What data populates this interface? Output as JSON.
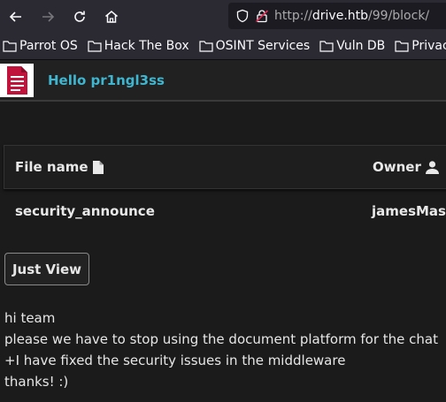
{
  "browser": {
    "url_prefix": "http://",
    "url_host": "drive.htb",
    "url_path": "/99/block/",
    "bookmarks": [
      "Parrot OS",
      "Hack The Box",
      "OSINT Services",
      "Vuln DB",
      "Privacy"
    ]
  },
  "header": {
    "greeting": "Hello pr1ngl3ss"
  },
  "table": {
    "columns": {
      "file_name": "File name",
      "owner": "Owner"
    },
    "rows": [
      {
        "file_name": "security_announce",
        "owner": "jamesMason"
      }
    ]
  },
  "actions": {
    "just_view": "Just View"
  },
  "message": {
    "lines": [
      "hi team",
      "please we have to stop using the document platform for the chat",
      "+I have fixed the security issues in the middleware",
      "thanks! :)"
    ]
  }
}
